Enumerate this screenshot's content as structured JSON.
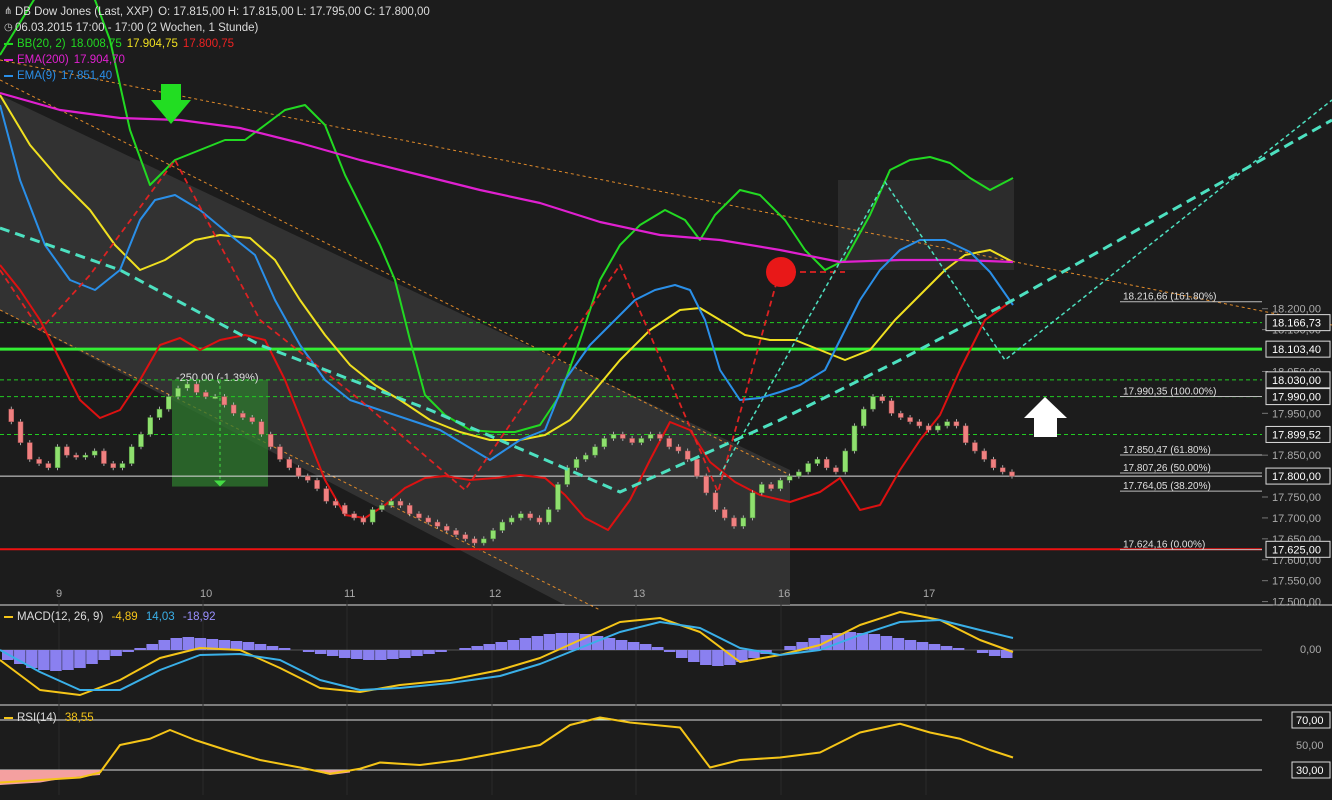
{
  "header": {
    "title": "DB Dow Jones (Last, XXP)",
    "ohlc": "O: 17.815,00  H: 17.815,00  L: 17.795,00  C: 17.800,00",
    "period": "06.03.2015 17:00 - 17:00 (2 Wochen, 1 Stunde)"
  },
  "legend": {
    "bb": {
      "label": "BB(20, 2)",
      "v1": "18.008,75",
      "v2": "17.904,75",
      "v3": "17.800,75"
    },
    "ema200": {
      "label": "EMA(200)",
      "v1": "17.904,70"
    },
    "ema9": {
      "label": "EMA(9)",
      "v1": "17.851,40"
    }
  },
  "colors": {
    "background": "#1c1c1c",
    "bullish": "#8fe06e",
    "bearish": "#f08080",
    "bb_upper": "#22d922",
    "bb_mid": "#f0e020",
    "bb_lower": "#dd1111",
    "ema200": "#e020d0",
    "ema9": "#2a8fe8",
    "pattern": "#4de0c0",
    "support_red": "#ee1111",
    "resistance_green": "#33ee33"
  },
  "icons": {
    "chart": "chart-icon",
    "clock": "clock-icon",
    "down_arrow": "down-arrow-icon",
    "up_arrow": "up-arrow-icon"
  },
  "price_axis_labels": [
    "18.200,00",
    "18.150,00",
    "18.050,00",
    "17.950,00",
    "17.850,00",
    "17.750,00",
    "17.700,00",
    "17.650,00",
    "17.600,00",
    "17.550,00",
    "17.500,00"
  ],
  "level_tags": [
    {
      "price": 18166.73,
      "label": "18.166,73"
    },
    {
      "price": 18103.4,
      "label": "18.103,40"
    },
    {
      "price": 18030,
      "label": "18.030,00"
    },
    {
      "price": 17990,
      "label": "17.990,00"
    },
    {
      "price": 17899.52,
      "label": "17.899,52"
    },
    {
      "price": 17800,
      "label": "17.800,00"
    },
    {
      "price": 17625,
      "label": "17.625,00"
    }
  ],
  "fib_levels": [
    {
      "price": 18216.66,
      "label": "18.216,66 (161.80%)"
    },
    {
      "price": 17990.35,
      "label": "17.990,35 (100.00%)"
    },
    {
      "price": 17850.47,
      "label": "17.850,47 (61.80%)"
    },
    {
      "price": 17807.26,
      "label": "17.807,26 (50.00%)"
    },
    {
      "price": 17764.05,
      "label": "17.764,05 (38.20%)"
    },
    {
      "price": 17624.16,
      "label": "17.624,16 (0.00%)"
    }
  ],
  "annotation_box": {
    "label": "-250,00 (-1.39%)"
  },
  "macd": {
    "label": "MACD(12, 26, 9)",
    "v1": "-4,89",
    "v2": "14,03",
    "v3": "-18,92",
    "axis_label": "0,00"
  },
  "rsi": {
    "label": "RSI(14)",
    "v1": "38,55",
    "axis_labels": [
      "70,00",
      "50,00",
      "30,00"
    ]
  },
  "chart_data": {
    "type": "candlestick",
    "x_ticks": [
      "9",
      "10",
      "11",
      "12",
      "13",
      "16",
      "17"
    ],
    "ylim": [
      17500,
      18230
    ],
    "grid": false,
    "candles_hourly_close": [
      17960,
      17930,
      17880,
      17840,
      17830,
      17820,
      17870,
      17850,
      17845,
      17850,
      17860,
      17830,
      17820,
      17830,
      17870,
      17900,
      17940,
      17960,
      17990,
      18010,
      18020,
      18000,
      17990,
      17990,
      17970,
      17950,
      17940,
      17930,
      17900,
      17870,
      17840,
      17820,
      17800,
      17790,
      17770,
      17740,
      17730,
      17710,
      17700,
      17690,
      17720,
      17730,
      17740,
      17730,
      17710,
      17700,
      17690,
      17680,
      17670,
      17660,
      17650,
      17640,
      17650,
      17670,
      17690,
      17700,
      17710,
      17700,
      17690,
      17720,
      17780,
      17820,
      17840,
      17850,
      17870,
      17890,
      17900,
      17890,
      17880,
      17890,
      17900,
      17890,
      17870,
      17860,
      17840,
      17800,
      17760,
      17720,
      17700,
      17680,
      17700,
      17760,
      17780,
      17770,
      17790,
      17800,
      17810,
      17830,
      17840,
      17820,
      17810,
      17860,
      17920,
      17960,
      17990,
      17980,
      17950,
      17940,
      17930,
      17920,
      17910,
      17920,
      17930,
      17920,
      17880,
      17860,
      17840,
      17820,
      17810,
      17800
    ],
    "support_line": 17625,
    "resistance_line": 18103.4,
    "macd_hist_note": "histogram below/above zero as shown",
    "rsi_bands": [
      70,
      30
    ]
  }
}
